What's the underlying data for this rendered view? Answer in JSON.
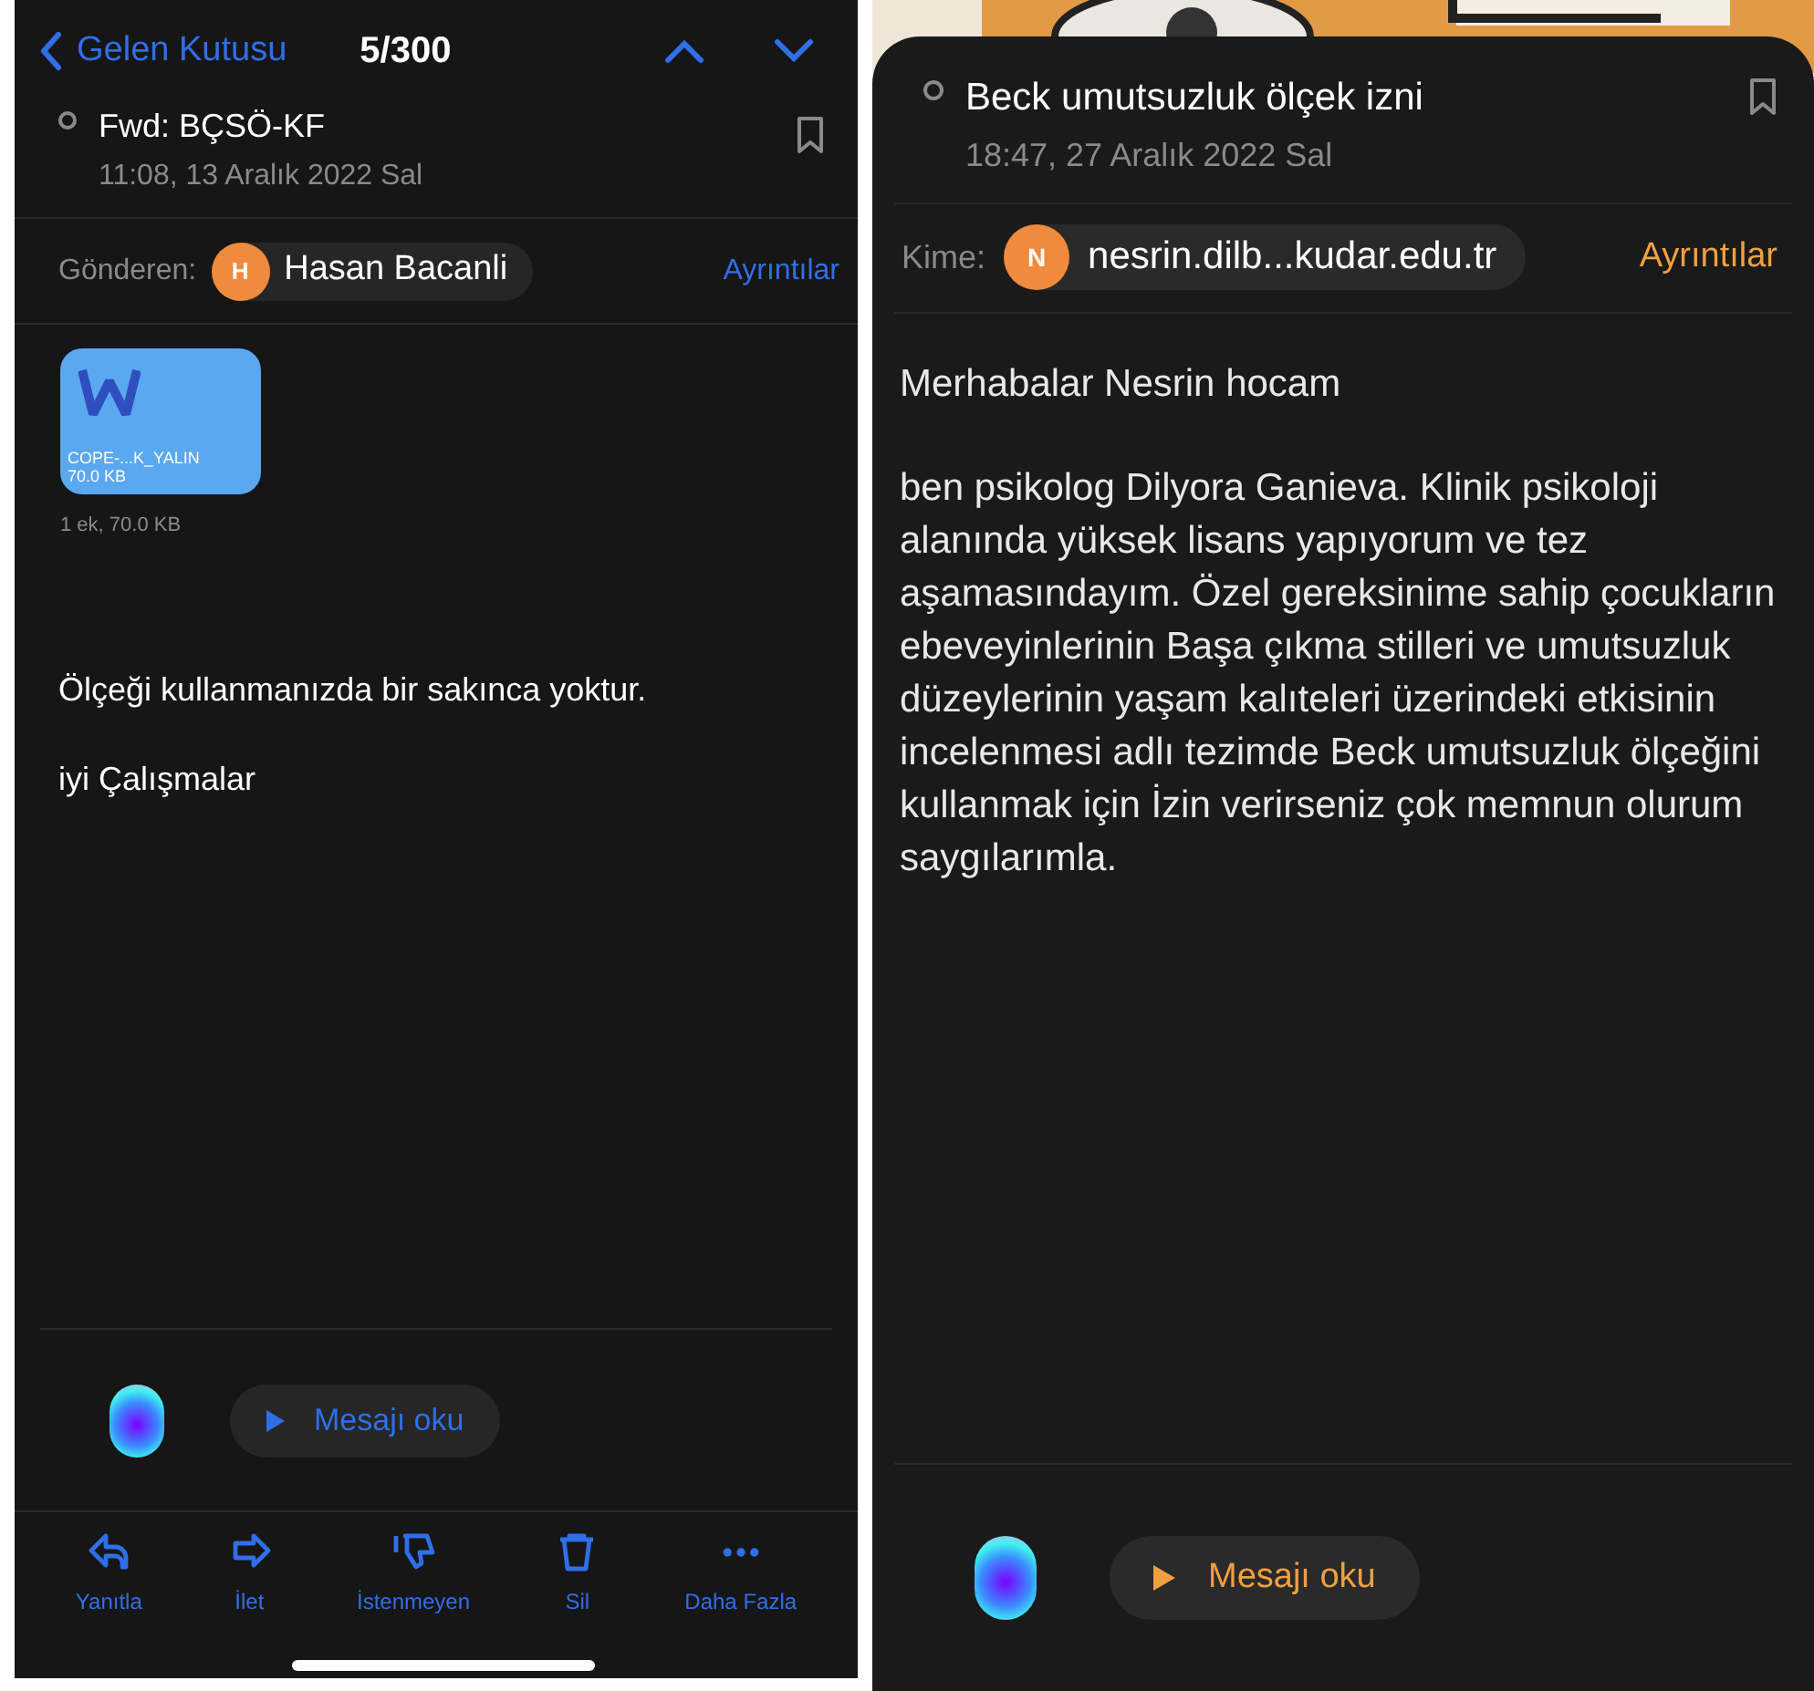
{
  "left_screen": {
    "header": {
      "back_label": "Gelen Kutusu",
      "counter": "5/300"
    },
    "message": {
      "subject": "Fwd: BÇSÖ-KF",
      "date": "11:08, 13 Aralık 2022 Sal",
      "read": true
    },
    "sender": {
      "label": "Gönderen:",
      "initial": "H",
      "name": "Hasan Bacanli"
    },
    "details_link": "Ayrıntılar",
    "attachment": {
      "name": "COPE-...K_YALIN",
      "size": "70.0 KB",
      "summary": "1 ek, 70.0 KB"
    },
    "body": [
      "Ölçeği kullanmanızda bir sakınca yoktur.",
      "iyi Çalışmalar"
    ],
    "read_aloud": "Mesajı oku",
    "toolbar": [
      {
        "kind": "reply",
        "label": "Yanıtla"
      },
      {
        "kind": "forward",
        "label": "İlet"
      },
      {
        "kind": "junk",
        "label": "İstenmeyen"
      },
      {
        "kind": "trash",
        "label": "Sil"
      },
      {
        "kind": "more",
        "label": "Daha Fazla"
      }
    ]
  },
  "right_screen": {
    "message": {
      "subject": "Beck umutsuzluk ölçek izni",
      "date": "18:47, 27 Aralık 2022 Sal",
      "read": true
    },
    "recipient": {
      "label": "Kime:",
      "initial": "N",
      "address": "nesrin.dilb...kudar.edu.tr"
    },
    "details_link": "Ayrıntılar",
    "body": [
      "Merhabalar Nesrin hocam",
      "ben psikolog Dilyora Ganieva. Klinik psikoloji alanında yüksek lisans yapıyorum ve tez aşamasındayım. Özel gereksinime sahip çocukların ebeveyinlerinin Başa çıkma stilleri ve umutsuzluk düzeylerinin yaşam kalıteleri üzerindeki etkisinin incelenmesi adlı tezimde Beck umutsuzluk ölçeğini kullanmak için İzin verirseniz çok memnun olurum saygılarımla."
    ],
    "read_aloud": "Mesajı oku"
  }
}
